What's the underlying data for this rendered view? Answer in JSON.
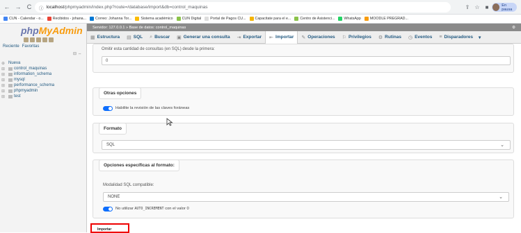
{
  "browser": {
    "back": "←",
    "forward": "→",
    "reload": "C",
    "url_host": "localhost",
    "url_path": "/phpmyadmin/index.php?route=/database/import&db=control_maquinas",
    "profile_label": "En pausa"
  },
  "bookmarks": [
    "CUN - Calendar - o...",
    "Recibidos - johana...",
    "Correo: Johanna Tor...",
    "Sistema académico",
    "CUN Digital",
    "Portal de Pagos CU...",
    "Capacitate para el e...",
    "Centro de Asistenci...",
    "WhatsApp",
    "MOODLE PREGRAD..."
  ],
  "sidebar": {
    "logo_php": "php",
    "logo_my": "MyAdmin",
    "tab_recent": "Reciente",
    "tab_favorites": "Favoritas",
    "tree": [
      {
        "label": "Nueva"
      },
      {
        "label": "control_maquinas"
      },
      {
        "label": "information_schema"
      },
      {
        "label": "mysql"
      },
      {
        "label": "performance_schema"
      },
      {
        "label": "phpmyadmin"
      },
      {
        "label": "test"
      }
    ]
  },
  "top": {
    "breadcrumb": "Servidor: 127.0.0.1 » Base de datos: control_maquinas"
  },
  "tabs": [
    {
      "label": "Estructura",
      "icon": "structure-icon"
    },
    {
      "label": "SQL",
      "icon": "sql-icon"
    },
    {
      "label": "Buscar",
      "icon": "search-icon"
    },
    {
      "label": "Generar una consulta",
      "icon": "query-icon"
    },
    {
      "label": "Exportar",
      "icon": "export-icon"
    },
    {
      "label": "Importar",
      "icon": "import-icon"
    },
    {
      "label": "Operaciones",
      "icon": "wrench-icon"
    },
    {
      "label": "Privilegios",
      "icon": "privileges-icon"
    },
    {
      "label": "Rutinas",
      "icon": "routines-icon"
    },
    {
      "label": "Eventos",
      "icon": "clock-icon"
    },
    {
      "label": "Disparadores",
      "icon": "triggers-icon"
    }
  ],
  "content": {
    "skip_label": "Omitir esta cantidad de consultas (en SQL) desde la primera:",
    "skip_value": "0",
    "other_options_legend": "Otras opciones",
    "foreign_keys_label": "Habilite la revisión de las claves foráneas",
    "format_legend": "Formato",
    "format_value": "SQL",
    "format_specific_legend": "Opciones específicas al formato:",
    "sql_compat_label": "Modalidad SQL compatible:",
    "sql_compat_value": "NONE",
    "auto_inc_label_pre": "No utilizar",
    "auto_inc_code": "AUTO_INCREMENT",
    "auto_inc_label_post": "con el valor 0",
    "import_button": "Importar"
  }
}
